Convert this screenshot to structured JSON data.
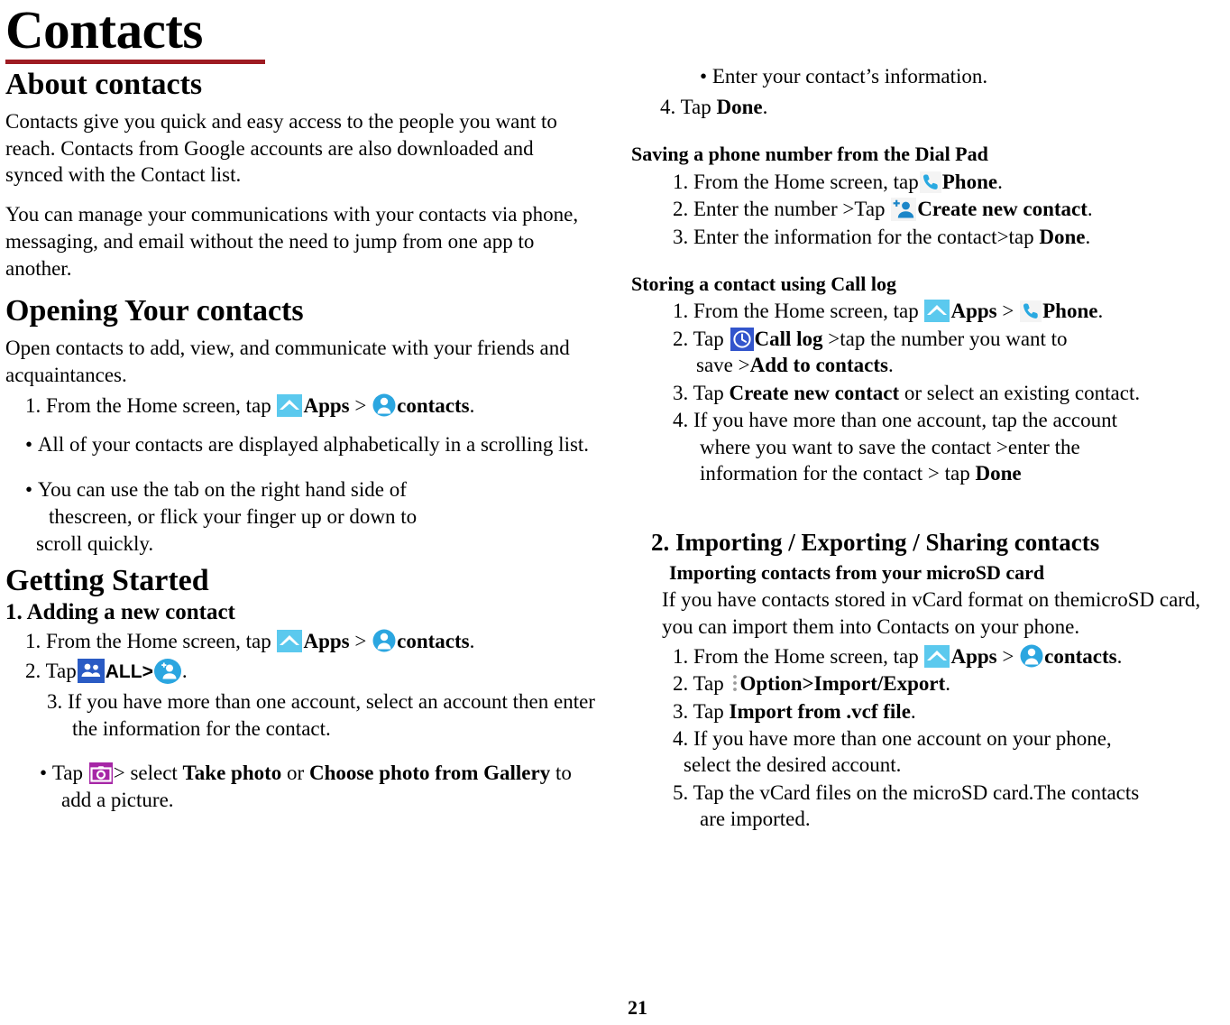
{
  "page": {
    "title": "Contacts",
    "page_number": "21",
    "accent_rule_color": "#9E1B22"
  },
  "icons": {
    "apps": {
      "name": "apps-icon",
      "bg": "#5BC9EE",
      "fg": "#FFFFFF"
    },
    "contacts": {
      "name": "contacts-icon",
      "bg": "#2BA6E0",
      "fg": "#FFFFFF"
    },
    "all_contacts": {
      "name": "all-contacts-icon",
      "bg": "#2A5BC4",
      "fg": "#FFFFFF"
    },
    "add_contact": {
      "name": "add-contact-icon",
      "bg": "#2BA6E0",
      "fg": "#FFFFFF"
    },
    "camera": {
      "name": "camera-icon",
      "bg": "#A626A6",
      "fg": "#FFFFFF"
    },
    "phone": {
      "name": "phone-icon",
      "bg": "#F2F2F2",
      "fg": "#29A9E1"
    },
    "create_new_contact": {
      "name": "create-new-contact-icon",
      "bg": "#F2F2F2",
      "fg": "#1C86C8"
    },
    "call_log": {
      "name": "call-log-icon",
      "bg": "#3355CC",
      "fg": "#FFFFFF"
    },
    "option_menu": {
      "name": "overflow-menu-icon",
      "fg": "#9A9A9A"
    }
  },
  "left": {
    "about": {
      "heading": "About contacts",
      "p1": "Contacts give you quick and easy access to the people you want to reach. Contacts from Google accounts are also downloaded and synced with the Contact list.",
      "p2": "You can manage your communications with your contacts via phone, messaging, and email without the need to jump from one app to another."
    },
    "opening": {
      "heading": "Opening Your contacts",
      "intro": "Open contacts to add, view, and communicate with your friends and acquaintances.",
      "step1_pre": "1. From the Home screen, tap ",
      "step1_apps": "Apps",
      "step1_gt": " > ",
      "step1_contacts": "contacts",
      "step1_end": ".",
      "bullet1": "All of your contacts are displayed alphabetically in a scrolling list.",
      "bullet2_a": "You can use the tab on the right hand side of",
      "bullet2_b": "thescreen, or flick your finger up or down to",
      "bullet2_c": "scroll quickly."
    },
    "getting_started": {
      "heading": "Getting Started",
      "sub1": "1. Adding a new contact",
      "step1_pre": "1. From the Home screen, tap ",
      "step1_apps": "Apps",
      "step1_gt": " > ",
      "step1_contacts": "contacts",
      "step1_end": ".",
      "step2_pre": "2. Tap",
      "step2_all": "ALL>",
      "step2_end": ".",
      "step3": "3. If you have more than one account, select an account then enter the information for the contact.",
      "bullet_pre": "Tap ",
      "bullet_mid": "> select ",
      "bullet_b1": "Take photo",
      "bullet_or": " or ",
      "bullet_b2": "Choose photo from Gallery",
      "bullet_end": " to add a picture."
    }
  },
  "right": {
    "adding_cont": {
      "bullet": "Enter your contact’s information.",
      "step4_pre": "4. Tap ",
      "step4_b": "Done",
      "step4_end": "."
    },
    "dialpad": {
      "heading": "Saving a phone number from the Dial Pad",
      "s1_pre": "1. From the Home screen, tap",
      "s1_b": "Phone",
      "s1_end": ".",
      "s2_pre": "2. Enter the number >Tap ",
      "s2_b": "Create new contact",
      "s2_end": ".",
      "s3_pre": "3. Enter the information for the contact>tap ",
      "s3_b": "Done",
      "s3_end": "."
    },
    "calllog": {
      "heading": "Storing a contact using Call log",
      "s1_pre": "1. From the Home screen, tap ",
      "s1_apps": "Apps",
      "s1_gt": " > ",
      "s1_phone": "Phone",
      "s1_end": ".",
      "s2_pre": "2. Tap ",
      "s2_b1": "Call log",
      "s2_mid": " >tap the number you want to",
      "s2_line2_pre": "save >",
      "s2_b2": "Add to contacts",
      "s2_end": ".",
      "s3_pre": "3. Tap ",
      "s3_b": "Create new contact",
      "s3_end": " or select an existing contact.",
      "s4_line1": "4. If you have more than one account, tap the account",
      "s4_line2": "where you want to save the contact >enter the",
      "s4_line3_pre": "information for the contact > tap ",
      "s4_line3_b": "Done"
    },
    "importing": {
      "heading": "2. Importing / Exporting / Sharing contacts",
      "sub": "Importing contacts from your microSD card",
      "intro": "If you have contacts stored in vCard format on themicroSD card, you can import them into Contacts on your phone.",
      "s1_pre": "1. From the Home screen, tap ",
      "s1_apps": "Apps",
      "s1_gt": " > ",
      "s1_contacts": "contacts",
      "s1_end": ".",
      "s2_pre": "2. Tap ",
      "s2_b": "Option>Import/Export",
      "s2_end": ".",
      "s3_pre": "3. Tap ",
      "s3_b": "Import from .vcf file",
      "s3_end": ".",
      "s4_line1": "4. If you have more than one account on your phone,",
      "s4_line2": "select the desired account.",
      "s5_line1": "5. Tap the vCard files on the microSD card.The contacts",
      "s5_line2": "are imported."
    }
  }
}
